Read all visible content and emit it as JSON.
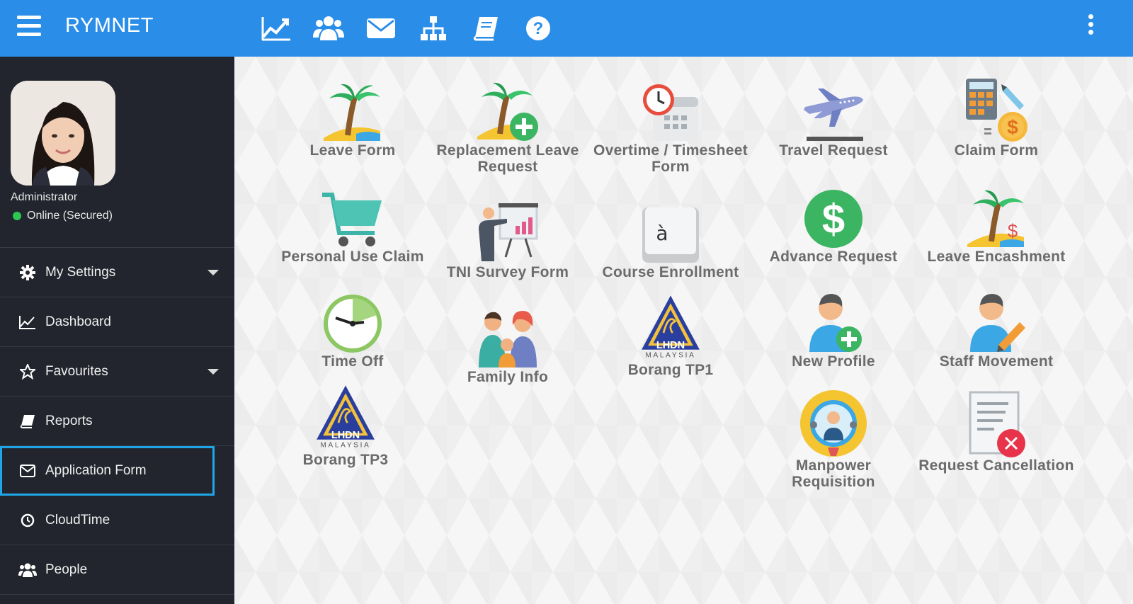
{
  "app": {
    "title": "RYMNET"
  },
  "topnav": [
    {
      "icon": "line-chart-icon"
    },
    {
      "icon": "users-icon"
    },
    {
      "icon": "envelope-icon"
    },
    {
      "icon": "org-chart-icon"
    },
    {
      "icon": "book-icon"
    },
    {
      "icon": "question-icon"
    }
  ],
  "user": {
    "role": "Administrator",
    "status": "Online (Secured)"
  },
  "sidebar": {
    "items": [
      {
        "label": "My Settings",
        "icon": "gear-icon"
      },
      {
        "label": "Dashboard",
        "icon": "line-chart-icon"
      },
      {
        "label": "Favourites",
        "icon": "star-icon"
      },
      {
        "label": "Reports",
        "icon": "book-icon"
      },
      {
        "label": "Application Form",
        "icon": "envelope-icon"
      },
      {
        "label": "CloudTime",
        "icon": "clock-icon"
      },
      {
        "label": "People",
        "icon": "users-icon"
      }
    ]
  },
  "tiles": [
    {
      "label": "Leave Form",
      "icon": "palm-tree-icon"
    },
    {
      "label": "Replacement Leave Request",
      "icon": "palm-tree-plus-icon"
    },
    {
      "label": "Overtime / Timesheet Form",
      "icon": "clock-calendar-icon"
    },
    {
      "label": "Travel Request",
      "icon": "airplane-icon"
    },
    {
      "label": "Claim Form",
      "icon": "calculator-coin-icon"
    },
    {
      "label": "Personal Use Claim",
      "icon": "shopping-cart-icon"
    },
    {
      "label": "TNI Survey Form",
      "icon": "presentation-icon"
    },
    {
      "label": "Course Enrollment",
      "icon": "keyboard-key-icon",
      "key": "à"
    },
    {
      "label": "Advance Request",
      "icon": "dollar-circle-icon"
    },
    {
      "label": "Leave Encashment",
      "icon": "palm-tree-dollar-icon"
    },
    {
      "label": "Time Off",
      "icon": "timer-icon"
    },
    {
      "label": "Family Info",
      "icon": "family-icon"
    },
    {
      "label": "Borang TP1",
      "icon": "lhdn-logo-icon",
      "logo_text": "LHDN",
      "logo_sub": "MALAYSIA"
    },
    {
      "label": "New Profile",
      "icon": "user-plus-icon"
    },
    {
      "label": "Staff Movement",
      "icon": "user-pencil-icon"
    },
    {
      "label": "Borang TP3",
      "icon": "lhdn-logo-icon",
      "logo_text": "LHDN",
      "logo_sub": "MALAYSIA"
    },
    {
      "label": "Manpower Requisition",
      "icon": "manpower-icon"
    },
    {
      "label": "Request Cancellation",
      "icon": "document-cancel-icon"
    }
  ]
}
